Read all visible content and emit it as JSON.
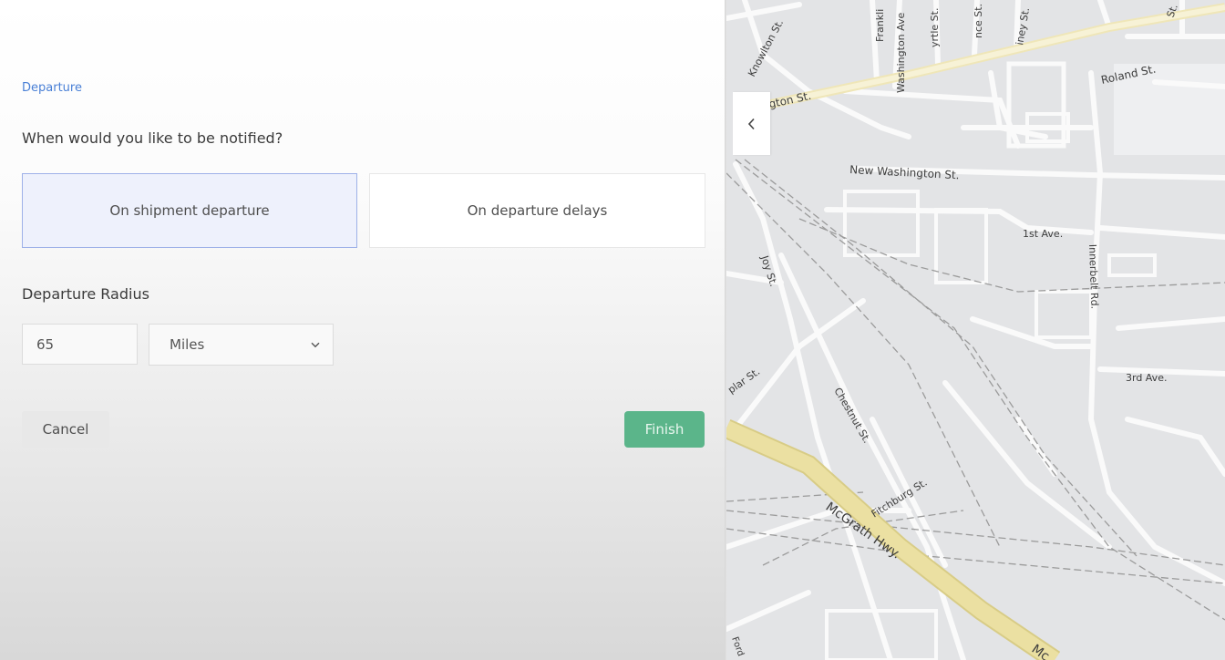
{
  "form": {
    "section_label": "Departure",
    "question": "When would you like to be notified?",
    "options": [
      {
        "label": "On shipment departure",
        "selected": true
      },
      {
        "label": "On departure delays",
        "selected": false
      }
    ],
    "radius": {
      "label": "Departure Radius",
      "value": "65",
      "unit": "Miles"
    },
    "cancel_label": "Cancel",
    "finish_label": "Finish"
  },
  "map": {
    "streets": {
      "knowlton": "Knowlton St.",
      "franklin": "Frankli",
      "washington_ave": "Washington Ave",
      "myrtle": "yrtle St.",
      "prospect": "nce St.",
      "cobble": "iney St.",
      "corner": "St.",
      "washington": "ngton St.",
      "roland": "Roland St.",
      "new_washington": "New Washington St.",
      "first_ave": "1st Ave.",
      "innerbelt": "Innerbelt Rd.",
      "joy": "Joy St.",
      "poplar": "plar St.",
      "chestnut": "Chestnut St.",
      "third_ave": "3rd Ave.",
      "fitchburg": "Fitchburg St.",
      "mcgrath": "McGrath Hwy.",
      "mcgrath_edge": "Mc",
      "bottom_left": "Ford"
    },
    "colors": {
      "background": "#e3e4e6",
      "road": "#fafafa",
      "highway": "#e8dc98",
      "rail": "#9b9b9b"
    }
  },
  "colors": {
    "accent": "#4a80d6",
    "selected_bg": "#eef1fc",
    "finish": "#5bb58a"
  }
}
